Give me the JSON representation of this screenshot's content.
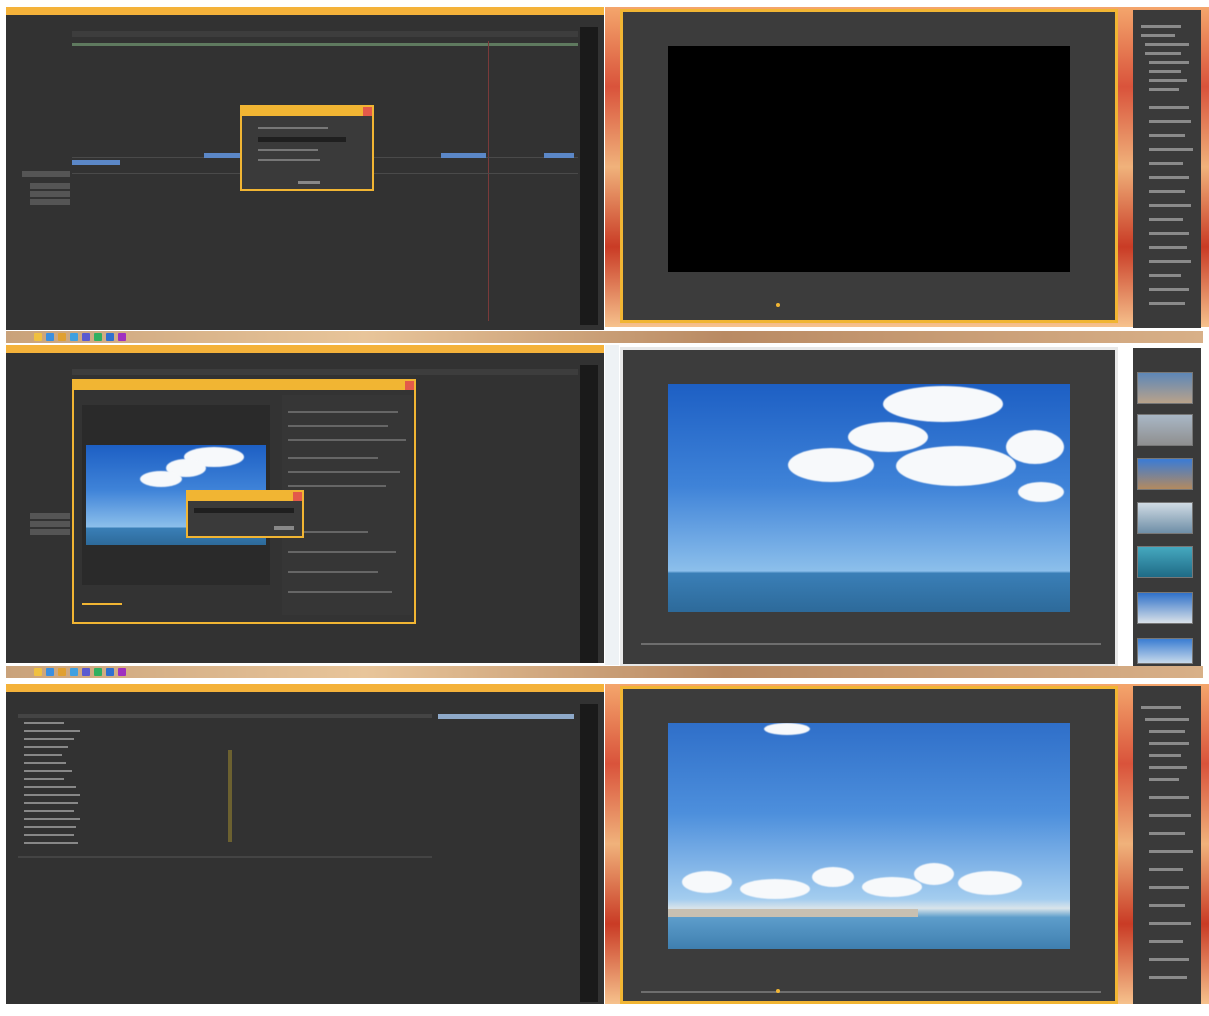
{
  "apps": {
    "top_left_title": "",
    "status": ""
  },
  "icons": [
    "folder-icon",
    "ie-icon",
    "explorer-icon",
    "store-icon",
    "media-icon",
    "settings-icon",
    "photos-icon",
    "app-icon"
  ],
  "colors": {
    "accent": "#f1b533",
    "panel": "#323232",
    "clip": "#5b87c7",
    "close": "#e35a4a"
  }
}
